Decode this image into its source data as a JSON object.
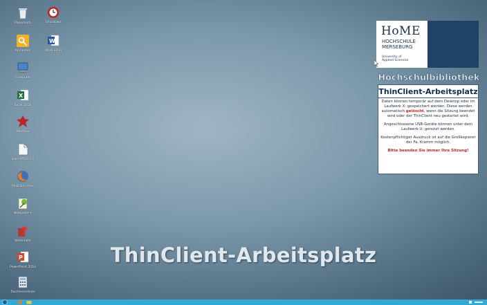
{
  "desktop": {
    "icons": [
      {
        "label": "Papierkorb",
        "icon": "recycle-bin-icon"
      },
      {
        "label": "Shutdown",
        "icon": "shutdown-clock-icon"
      },
      {
        "label": "Anmelden",
        "icon": "key-icon"
      },
      {
        "label": "Word 2010",
        "icon": "word-icon"
      },
      {
        "label": "Computer",
        "icon": "computer-icon"
      },
      {
        "label": "Excel 2010",
        "icon": "excel-icon"
      },
      {
        "label": "Wortbox",
        "icon": "wortbox-icon"
      },
      {
        "label": "LibreOffice 5.0",
        "icon": "libreoffice-icon"
      },
      {
        "label": "Mozilla Firefox",
        "icon": "firefox-icon"
      },
      {
        "label": "Notepad++",
        "icon": "notepadpp-icon"
      },
      {
        "label": "Notenhilfe",
        "icon": "help-icon"
      },
      {
        "label": "PowerPoint 2010",
        "icon": "powerpoint-icon"
      },
      {
        "label": "Taschenrechner",
        "icon": "calculator-icon"
      }
    ],
    "banner": "ThinClient-Arbeitsplatz"
  },
  "logo": {
    "line1": "HoME",
    "line2": "HOCHSCHULE",
    "line3": "MERSEBURG",
    "line4": "University of",
    "line5": "Applied Sciences",
    "color": "#1d4466"
  },
  "library": "Hochschulbibliothek",
  "panel": {
    "title": "ThinClient-Arbeitsplatz",
    "p1_a": "Daten können temporär auf dem Desktop oder im Laufwerk X: gespeichert werden. Diese werden automatisch ",
    "p1_red": "gelöscht",
    "p1_b": ", wenn die Sitzung beendet wird oder der ThinClient neu gestartet wird.",
    "p2": "Angeschlossene USB-Geräte können unter dem Laufwerk U: genutzt werden.",
    "p3": "Kostenpflichtiger Ausdruck ist auf die Großkopierer der Fa. Kramm möglich.",
    "p4": "Bitte beenden Sie immer Ihre Sitzung!"
  },
  "colors": {
    "accent_red": "#c8231c",
    "navy": "#0f2d4c",
    "taskbar": "#33a9d6"
  }
}
